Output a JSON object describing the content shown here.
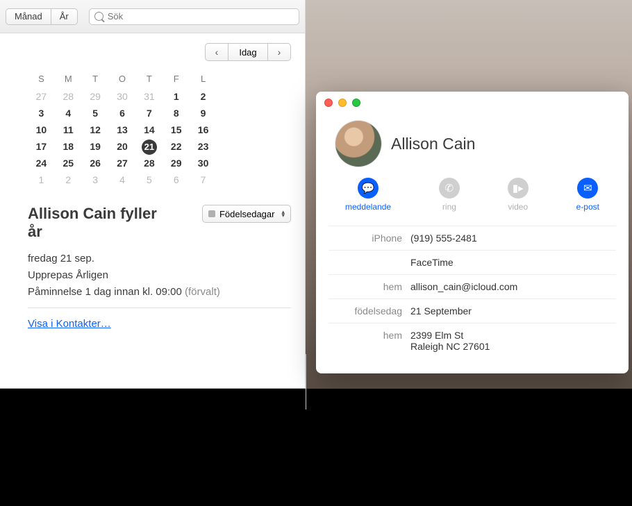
{
  "cal_toolbar": {
    "view_month": "Månad",
    "view_year": "År",
    "search_placeholder": "Sök"
  },
  "cal_nav": {
    "today": "Idag"
  },
  "dow": [
    "S",
    "M",
    "T",
    "O",
    "T",
    "F",
    "L"
  ],
  "weeks": [
    [
      {
        "d": "27",
        "o": true
      },
      {
        "d": "28",
        "o": true
      },
      {
        "d": "29",
        "o": true
      },
      {
        "d": "30",
        "o": true
      },
      {
        "d": "31",
        "o": true
      },
      {
        "d": "1",
        "o": false
      },
      {
        "d": "2",
        "o": false
      }
    ],
    [
      {
        "d": "3",
        "o": false
      },
      {
        "d": "4",
        "o": false
      },
      {
        "d": "5",
        "o": false
      },
      {
        "d": "6",
        "o": false
      },
      {
        "d": "7",
        "o": false
      },
      {
        "d": "8",
        "o": false
      },
      {
        "d": "9",
        "o": false
      }
    ],
    [
      {
        "d": "10",
        "o": false
      },
      {
        "d": "11",
        "o": false
      },
      {
        "d": "12",
        "o": false
      },
      {
        "d": "13",
        "o": false
      },
      {
        "d": "14",
        "o": false
      },
      {
        "d": "15",
        "o": false
      },
      {
        "d": "16",
        "o": false
      }
    ],
    [
      {
        "d": "17",
        "o": false
      },
      {
        "d": "18",
        "o": false
      },
      {
        "d": "19",
        "o": false
      },
      {
        "d": "20",
        "o": false
      },
      {
        "d": "21",
        "o": false,
        "today": true
      },
      {
        "d": "22",
        "o": false
      },
      {
        "d": "23",
        "o": false
      }
    ],
    [
      {
        "d": "24",
        "o": false
      },
      {
        "d": "25",
        "o": false
      },
      {
        "d": "26",
        "o": false
      },
      {
        "d": "27",
        "o": false
      },
      {
        "d": "28",
        "o": false
      },
      {
        "d": "29",
        "o": false
      },
      {
        "d": "30",
        "o": false
      }
    ],
    [
      {
        "d": "1",
        "o": true
      },
      {
        "d": "2",
        "o": true
      },
      {
        "d": "3",
        "o": true
      },
      {
        "d": "4",
        "o": true
      },
      {
        "d": "5",
        "o": true
      },
      {
        "d": "6",
        "o": true
      },
      {
        "d": "7",
        "o": true
      }
    ]
  ],
  "event": {
    "title": "Allison Cain fyller år",
    "calendar_label": "Födelsedagar",
    "date": "fredag 21 sep.",
    "repeat_label": "Upprepas",
    "repeat_value": "Årligen",
    "reminder_label": "Påminnelse",
    "reminder_value": "1 dag innan kl. 09:00",
    "reminder_default": "(förvalt)",
    "link": "Visa i Kontakter…"
  },
  "contact": {
    "name": "Allison Cain",
    "actions": {
      "message": "meddelande",
      "call": "ring",
      "video": "video",
      "mail": "e-post"
    },
    "fields": [
      {
        "label": "iPhone",
        "value": "(919) 555-2481"
      },
      {
        "label": "",
        "value": "FaceTime"
      },
      {
        "label": "hem",
        "value": "allison_cain@icloud.com"
      },
      {
        "label": "födelsedag",
        "value": "21 September"
      },
      {
        "label": "hem",
        "value": "2399 Elm St\nRaleigh NC 27601"
      }
    ]
  }
}
